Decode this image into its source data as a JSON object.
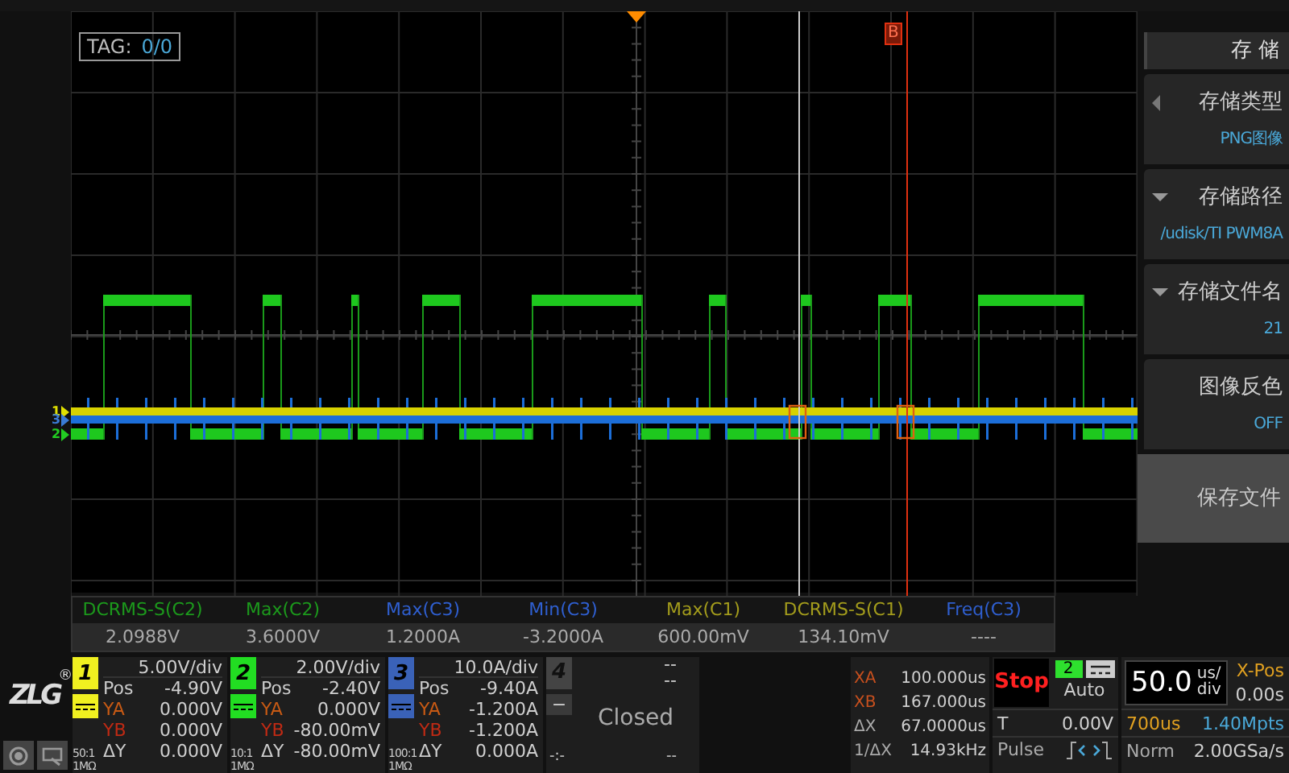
{
  "tag": {
    "label": "TAG:",
    "value": "0/0"
  },
  "cursor_b_label": "B",
  "level_markers": [
    {
      "label": "1",
      "color": "#e0e000"
    },
    {
      "label": "3",
      "color": "#3a7bd5"
    },
    {
      "label": "2",
      "color": "#22cc22"
    }
  ],
  "menu": {
    "title": "存 储",
    "items": [
      {
        "kind": "option",
        "label": "存储类型",
        "value": "PNG图像"
      },
      {
        "kind": "dropdown",
        "label": "存储路径",
        "value": "/udisk/TI PWM8A"
      },
      {
        "kind": "dropdown",
        "label": "存储文件名",
        "value": "21"
      },
      {
        "kind": "toggle",
        "label": "图像反色",
        "value": "OFF"
      },
      {
        "kind": "action",
        "label": "保存文件"
      }
    ]
  },
  "measurements": [
    {
      "label": "DCRMS-S(C2)",
      "value": "2.0988V",
      "color": "#1c9a1c"
    },
    {
      "label": "Max(C2)",
      "value": "3.6000V",
      "color": "#1c9a1c"
    },
    {
      "label": "Max(C3)",
      "value": "1.2000A",
      "color": "#2f5fd0"
    },
    {
      "label": "Min(C3)",
      "value": "-3.2000A",
      "color": "#2f5fd0"
    },
    {
      "label": "Max(C1)",
      "value": "600.00mV",
      "color": "#a39c1c"
    },
    {
      "label": "DCRMS-S(C1)",
      "value": "134.10mV",
      "color": "#a39c1c"
    },
    {
      "label": "Freq(C3)",
      "value": "----",
      "color": "#2f5fd0"
    }
  ],
  "logo": "ZLG",
  "logo_mark": "®",
  "channels": [
    {
      "number": "1",
      "color": "#f0f020",
      "scale": "5.00V/div",
      "pos_label": "Pos",
      "pos": "-4.90V",
      "ya_label": "YA",
      "ya": "0.000V",
      "yb_label": "YB",
      "yb": "0.000V",
      "dy_label": "ΔY",
      "dy": "0.000V",
      "probe": "50:1",
      "impedance": "1MΩ"
    },
    {
      "number": "2",
      "color": "#22dd22",
      "scale": "2.00V/div",
      "pos_label": "Pos",
      "pos": "-2.40V",
      "ya_label": "YA",
      "ya": "0.000V",
      "yb_label": "YB",
      "yb": "-80.00mV",
      "dy_label": "ΔY",
      "dy": "-80.00mV",
      "probe": "10:1",
      "impedance": "1MΩ"
    },
    {
      "number": "3",
      "color": "#3a62b8",
      "scale": "10.0A/div",
      "pos_label": "Pos",
      "pos": "-9.40A",
      "ya_label": "YA",
      "ya": "-1.200A",
      "yb_label": "YB",
      "yb": "-1.200A",
      "dy_label": "ΔY",
      "dy": "0.000A",
      "probe": "100:1",
      "impedance": "1MΩ"
    }
  ],
  "channel_4": {
    "number": "4",
    "scale": "--",
    "pos": "--",
    "coupling": "−",
    "status": "Closed",
    "delta": "-:-",
    "dy": "--"
  },
  "cursors": [
    {
      "label": "XA",
      "value": "100.000us"
    },
    {
      "label": "XB",
      "value": "167.000us"
    },
    {
      "label": "ΔX",
      "value": "67.0000us"
    },
    {
      "label": "1/ΔX",
      "value": "14.93kHz"
    }
  ],
  "trigger": {
    "run_state": "Stop",
    "source": "2",
    "mode": "Auto",
    "level_label": "T",
    "level": "0.00V",
    "type": "Pulse"
  },
  "timebase": {
    "scale": "50.0",
    "unit_top": "us/",
    "unit_bottom": "div",
    "xpos_label": "X-Pos",
    "xpos": "0.00s",
    "duration": "700us",
    "points": "1.40Mpts",
    "acq_mode": "Norm",
    "sample_rate": "2.00GSa/s"
  }
}
